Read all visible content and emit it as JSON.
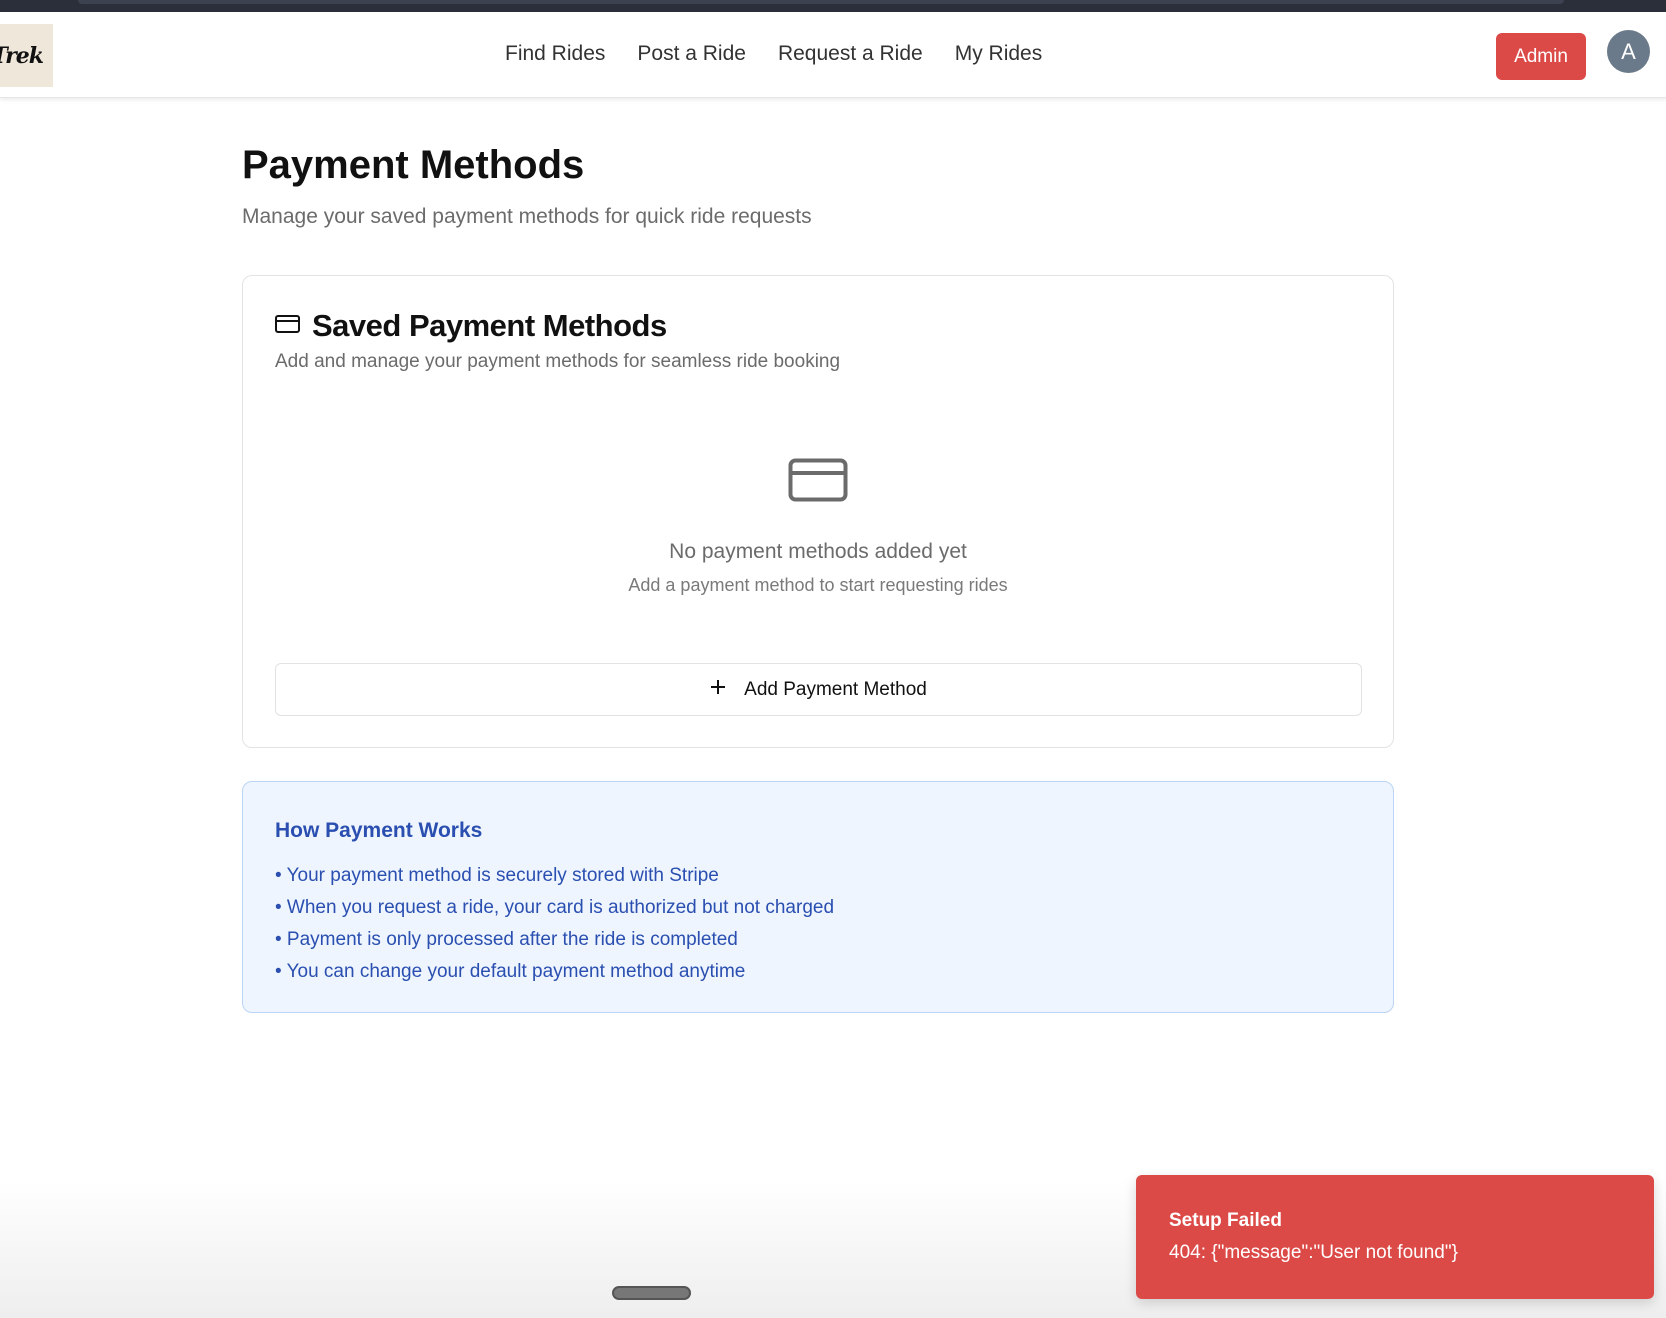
{
  "header": {
    "logo_text": "Trek",
    "nav": [
      {
        "label": "Find Rides"
      },
      {
        "label": "Post a Ride"
      },
      {
        "label": "Request a Ride"
      },
      {
        "label": "My Rides"
      }
    ],
    "admin_label": "Admin",
    "avatar_initial": "A"
  },
  "page": {
    "title": "Payment Methods",
    "subtitle": "Manage your saved payment methods for quick ride requests"
  },
  "saved_card": {
    "title": "Saved Payment Methods",
    "subtitle": "Add and manage your payment methods for seamless ride booking",
    "icon": "credit-card-icon",
    "empty_title": "No payment methods added yet",
    "empty_subtitle": "Add a payment method to start requesting rides",
    "add_button_label": "Add Payment Method"
  },
  "info": {
    "title": "How Payment Works",
    "items": [
      "• Your payment method is securely stored with Stripe",
      "• When you request a ride, your card is authorized but not charged",
      "• Payment is only processed after the ride is completed",
      "• You can change your default payment method anytime"
    ]
  },
  "toast": {
    "title": "Setup Failed",
    "message": "404: {\"message\":\"User not found\"}"
  },
  "colors": {
    "danger": "#dc4a47",
    "info_bg": "#eef5fe",
    "info_text": "#2a4fb0"
  }
}
